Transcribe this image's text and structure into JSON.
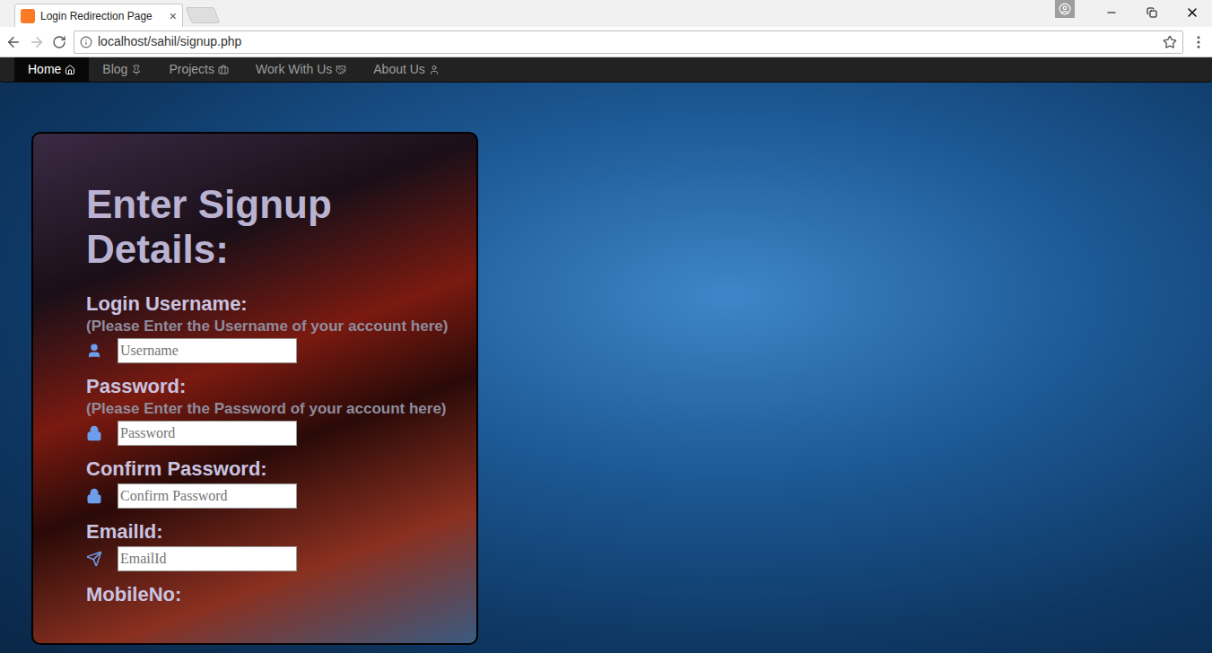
{
  "window": {
    "tab_title": "Login Redirection Page",
    "tab_close": "×",
    "address": "localhost/sahil/signup.php"
  },
  "nav": {
    "items": [
      {
        "label": "Home",
        "selected": true,
        "icon": "home"
      },
      {
        "label": "Blog",
        "selected": false,
        "icon": "pin"
      },
      {
        "label": "Projects",
        "selected": false,
        "icon": "briefcase"
      },
      {
        "label": "Work With Us",
        "selected": false,
        "icon": "handshake"
      },
      {
        "label": "About Us",
        "selected": false,
        "icon": "user"
      }
    ]
  },
  "form": {
    "heading": "Enter Signup Details:",
    "fields": [
      {
        "label": "Login Username:",
        "hint": "(Please Enter the Username of your account here)",
        "placeholder": "Username",
        "icon": "user"
      },
      {
        "label": "Password:",
        "hint": "(Please Enter the Password of your account here)",
        "placeholder": "Password",
        "icon": "lock"
      },
      {
        "label": "Confirm Password:",
        "hint": "",
        "placeholder": "Confirm Password",
        "icon": "lock"
      },
      {
        "label": "EmailId:",
        "hint": "",
        "placeholder": "EmailId",
        "icon": "send"
      },
      {
        "label": "MobileNo:",
        "hint": "",
        "placeholder": "",
        "icon": ""
      }
    ]
  }
}
